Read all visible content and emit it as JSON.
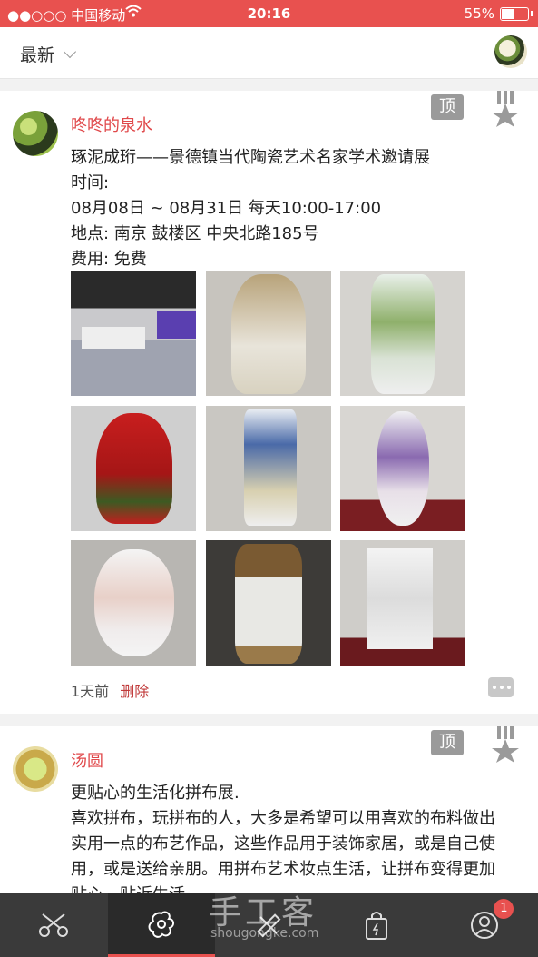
{
  "status": {
    "carrier": "●●○○○ 中国移动",
    "time": "20:16",
    "battery": "55%",
    "battery_level": 0.55
  },
  "header": {
    "filter_label": "最新"
  },
  "posts": [
    {
      "user": "咚咚的泉水",
      "top_label": "顶",
      "text": "琢泥成珩——景德镇当代陶瓷艺术名家学术邀请展\n时间:\n08月08日 ~ 08月31日 每天10:00-17:00\n地点: 南京 鼓楼区 中央北路185号\n费用: 免费",
      "time": "1天前",
      "delete_label": "删除"
    },
    {
      "user": "汤圆",
      "top_label": "顶",
      "text": "更贴心的生活化拼布展.\n喜欢拼布，玩拼布的人，大多是希望可以用喜欢的布料做出实用一点的布艺作品，这些作品用于装饰家居，或是自己使用，或是送给亲朋。用拼布艺术妆点生活，让拼布变得更加贴心，贴近生活。"
    }
  ],
  "tabbar": {
    "badge": "1"
  },
  "watermark": {
    "main": "手工客",
    "sub": "shougongke.com"
  },
  "colors": {
    "accent": "#e8514f",
    "username": "#e0494b",
    "tabbar": "#3a3a3a"
  }
}
